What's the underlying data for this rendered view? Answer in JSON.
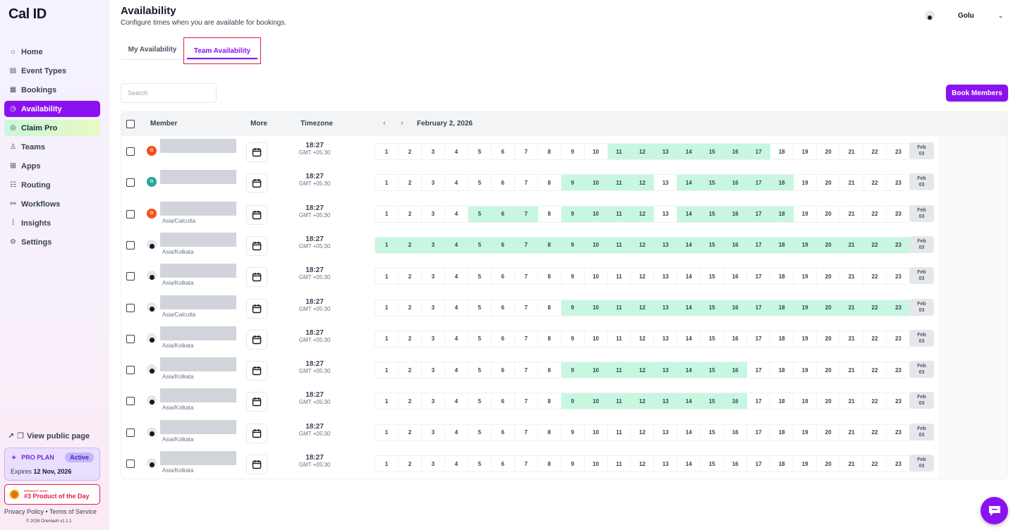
{
  "app": {
    "logo": "Cal ID"
  },
  "sidebar": {
    "items": [
      {
        "label": "Home",
        "icon": "home-icon",
        "glyph": "⌂"
      },
      {
        "label": "Event Types",
        "icon": "event-types-icon",
        "glyph": "▤"
      },
      {
        "label": "Bookings",
        "icon": "bookings-icon",
        "glyph": "▦"
      },
      {
        "label": "Availability",
        "icon": "clock-icon",
        "glyph": "◷",
        "active": true
      },
      {
        "label": "Claim Pro",
        "icon": "claim-pro-icon",
        "glyph": "◎",
        "claim": true
      },
      {
        "label": "Teams",
        "icon": "teams-icon",
        "glyph": "♙"
      },
      {
        "label": "Apps",
        "icon": "apps-icon",
        "glyph": "⊞"
      },
      {
        "label": "Routing",
        "icon": "routing-icon",
        "glyph": "☷"
      },
      {
        "label": "Workflows",
        "icon": "workflows-icon",
        "glyph": "⚯"
      },
      {
        "label": "Insights",
        "icon": "insights-icon",
        "glyph": "⫶"
      },
      {
        "label": "Settings",
        "icon": "settings-icon",
        "glyph": "⚙"
      }
    ],
    "public_page": "View public page",
    "plan": {
      "name": "PRO PLAN",
      "status": "Active",
      "expires_label": "Expires",
      "expires_date": "12 Nov, 2026"
    },
    "product_hunt": {
      "small": "PRODUCT HUNT",
      "title": "#3 Product of the Day"
    },
    "footer": {
      "privacy": "Privacy Policy",
      "sep": "•",
      "terms": "Terms of Service",
      "copyright": "© 2026 OneHash v1.1.1"
    }
  },
  "header": {
    "title": "Availability",
    "subtitle": "Configure times when you are available for bookings.",
    "user_name": "Golu"
  },
  "tabs": {
    "my": "My Availability",
    "team": "Team Availability"
  },
  "search": {
    "placeholder": "Search"
  },
  "book_button": "Book Members",
  "table": {
    "headers": {
      "member": "Member",
      "more": "More",
      "timezone": "Timezone",
      "date": "February 2, 2026"
    },
    "hours": [
      "1",
      "2",
      "3",
      "4",
      "5",
      "6",
      "7",
      "8",
      "9",
      "10",
      "11",
      "12",
      "13",
      "14",
      "15",
      "16",
      "17",
      "18",
      "19",
      "20",
      "21",
      "22",
      "23"
    ],
    "next_day": {
      "month": "Feb",
      "day": "03"
    },
    "rows": [
      {
        "avatar": "letter",
        "avatar_color": "#f4511e",
        "avatar_text": "G",
        "member_tz": "",
        "time": "18:27",
        "offset": "GMT +05:30",
        "available": [
          11,
          12,
          13,
          14,
          15,
          16,
          17
        ]
      },
      {
        "avatar": "letter",
        "avatar_color": "#26a69a",
        "avatar_text": "G",
        "member_tz": "",
        "time": "18:27",
        "offset": "GMT +05:30",
        "available": [
          9,
          10,
          11,
          12,
          14,
          15,
          16,
          17,
          18
        ]
      },
      {
        "avatar": "letter",
        "avatar_color": "#f4511e",
        "avatar_text": "G",
        "member_tz": "Asia/Calcutta",
        "time": "18:27",
        "offset": "GMT +05:30",
        "available": [
          5,
          6,
          7,
          9,
          10,
          11,
          12,
          14,
          15,
          16,
          17,
          18
        ]
      },
      {
        "avatar": "person",
        "member_tz": "Asia/Kolkata",
        "time": "18:27",
        "offset": "GMT +05:30",
        "available": [
          1,
          2,
          3,
          4,
          5,
          6,
          7,
          8,
          9,
          10,
          11,
          12,
          13,
          14,
          15,
          16,
          17,
          18,
          19,
          20,
          21,
          22,
          23
        ]
      },
      {
        "avatar": "person",
        "member_tz": "Asia/Kolkata",
        "time": "18:27",
        "offset": "GMT +05:30",
        "available": []
      },
      {
        "avatar": "person",
        "member_tz": "Asia/Calcutta",
        "time": "18:27",
        "offset": "GMT +05:30",
        "available": [
          9,
          10,
          11,
          12,
          13,
          14,
          15,
          16,
          17,
          18,
          19,
          20,
          21,
          22,
          23
        ]
      },
      {
        "avatar": "person",
        "member_tz": "Asia/Kolkata",
        "time": "18:27",
        "offset": "GMT +05:30",
        "available": []
      },
      {
        "avatar": "person",
        "member_tz": "Asia/Kolkata",
        "time": "18:27",
        "offset": "GMT +05:30",
        "available": [
          9,
          10,
          11,
          12,
          13,
          14,
          15,
          16
        ]
      },
      {
        "avatar": "person",
        "member_tz": "Asia/Kolkata",
        "time": "18:27",
        "offset": "GMT +05:30",
        "available": [
          9,
          10,
          11,
          12,
          13,
          14,
          15,
          16
        ]
      },
      {
        "avatar": "person",
        "member_tz": "Asia/Kolkata",
        "time": "18:27",
        "offset": "GMT +05:30",
        "available": []
      },
      {
        "avatar": "person",
        "member_tz": "Asia/Kolkata",
        "time": "18:27",
        "offset": "GMT +05:30",
        "available": []
      }
    ]
  },
  "colors": {
    "accent": "#8b12f0",
    "available": "#c8f7e1",
    "highlight_border": "#e11d48"
  }
}
